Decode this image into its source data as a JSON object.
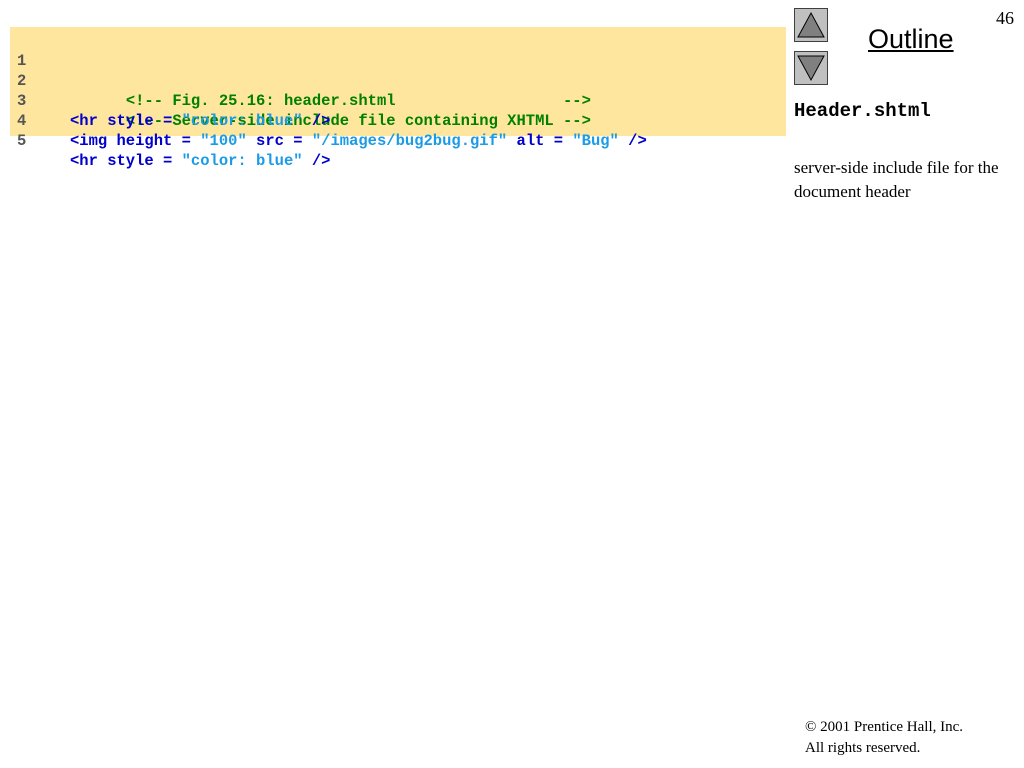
{
  "page_number": "46",
  "outline": {
    "title": "Outline",
    "up_icon": "up-triangle-icon",
    "down_icon": "down-triangle-icon"
  },
  "sidebar": {
    "file_title": "Header.shtml",
    "description": "server-side include file for the document header"
  },
  "code": {
    "colors": {
      "background": "#ffe69e",
      "line_number": "#555555",
      "comment": "#008000",
      "tag": "#0000cc",
      "string": "#1a9be6"
    },
    "lines": [
      {
        "number": "1",
        "tokens": [
          {
            "type": "comment",
            "text": "<!-- Fig. 25.16: header.shtml                  -->"
          }
        ]
      },
      {
        "number": "2",
        "tokens": [
          {
            "type": "comment",
            "text": "<!-- Server-side include file containing XHTML -->"
          }
        ]
      },
      {
        "number": "3",
        "tokens": [
          {
            "type": "tag",
            "text": "<hr style = "
          },
          {
            "type": "string",
            "text": "\"color: blue\""
          },
          {
            "type": "tag",
            "text": " />"
          }
        ]
      },
      {
        "number": "4",
        "tokens": [
          {
            "type": "tag",
            "text": "<img height = "
          },
          {
            "type": "string",
            "text": "\"100\""
          },
          {
            "type": "tag",
            "text": " src = "
          },
          {
            "type": "string",
            "text": "\"/images/bug2bug.gif\""
          },
          {
            "type": "tag",
            "text": " alt = "
          },
          {
            "type": "string",
            "text": "\"Bug\""
          },
          {
            "type": "tag",
            "text": " />"
          }
        ]
      },
      {
        "number": "5",
        "tokens": [
          {
            "type": "tag",
            "text": "<hr style = "
          },
          {
            "type": "string",
            "text": "\"color: blue\""
          },
          {
            "type": "tag",
            "text": " />"
          }
        ]
      }
    ]
  },
  "footer": {
    "copyright_line1": "© 2001 Prentice Hall, Inc.",
    "copyright_line2": "All rights reserved."
  }
}
